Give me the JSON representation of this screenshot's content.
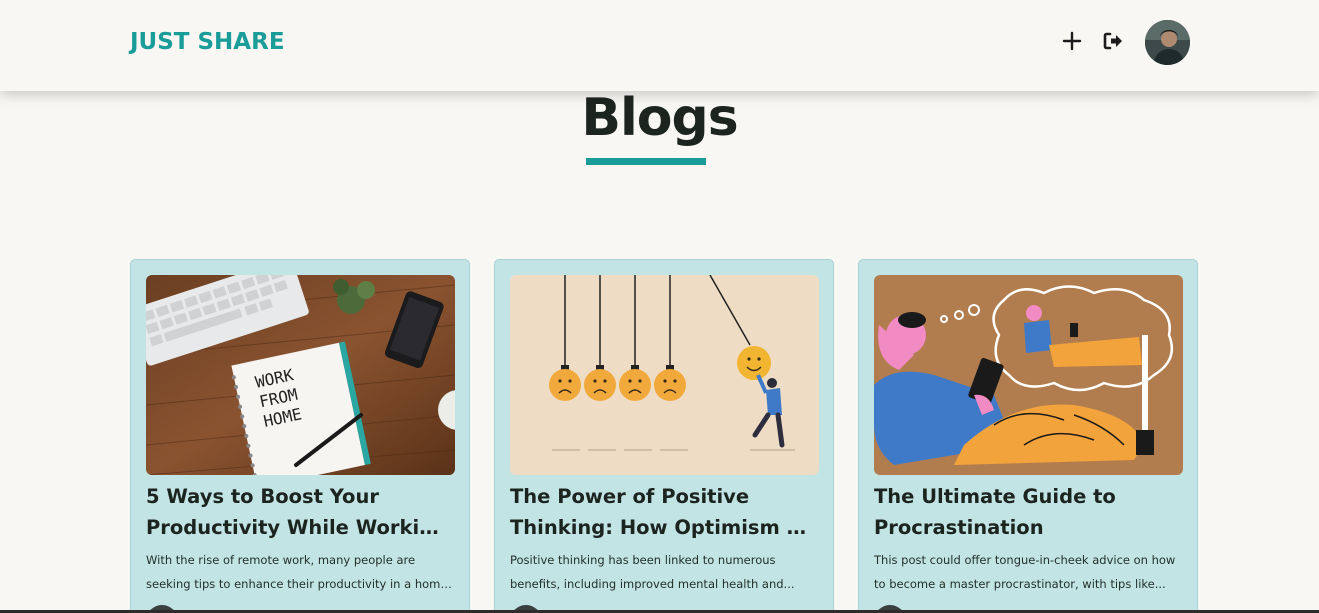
{
  "navbar": {
    "brand": "JUST SHARE",
    "add_icon": "plus-icon",
    "logout_icon": "logout-icon",
    "avatar_icon": "user-avatar"
  },
  "page": {
    "title": "Blogs",
    "accent_color": "#1a9c98"
  },
  "cards": [
    {
      "image_icon": "work-from-home-image",
      "image_text": "WORK FROM HOME",
      "title_line1": "5 Ways to Boost Your",
      "title_line2": "Productivity While Working...",
      "desc_line1": "With the rise of remote work, many people are",
      "desc_line2": "seeking tips to enhance their productivity in a home..."
    },
    {
      "image_icon": "optimism-pendulum-image",
      "title_line1": "The Power of Positive",
      "title_line2": "Thinking: How Optimism Ca...",
      "desc_line1": "Positive thinking has been linked to numerous",
      "desc_line2": "benefits, including improved mental health and..."
    },
    {
      "image_icon": "procrastination-illustration-image",
      "title_line1": "The Ultimate Guide to",
      "title_line2": "Procrastination",
      "desc_line1": "This post could offer tongue-in-cheek advice on how",
      "desc_line2": "to become a master procrastinator, with tips like..."
    }
  ]
}
